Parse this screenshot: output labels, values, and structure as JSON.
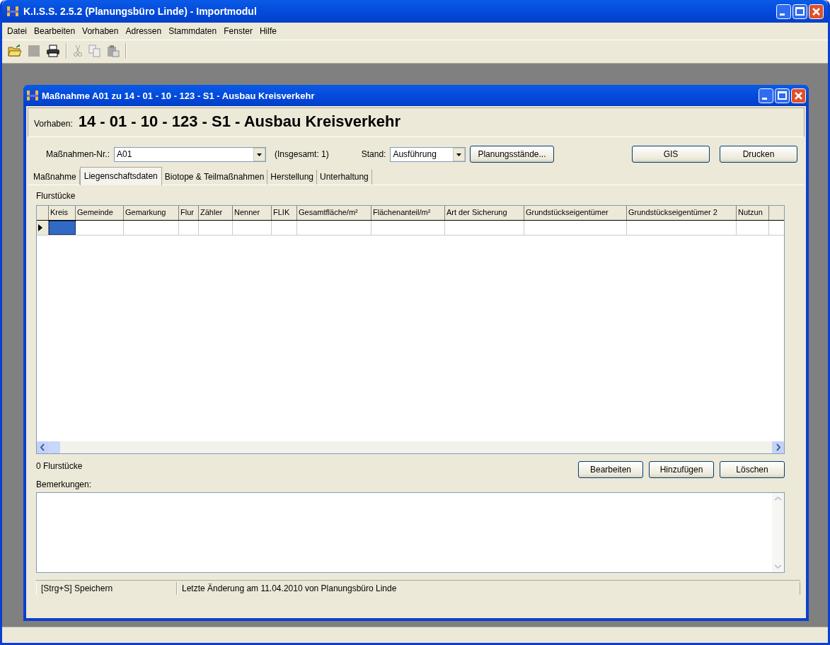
{
  "window": {
    "title": "K.I.S.S. 2.5.2 (Planungsbüro Linde) - Importmodul"
  },
  "menu": [
    "Datei",
    "Bearbeiten",
    "Vorhaben",
    "Adressen",
    "Stammdaten",
    "Fenster",
    "Hilfe"
  ],
  "toolbar": [
    {
      "kind": "open",
      "disabled": false
    },
    {
      "kind": "save",
      "disabled": true
    },
    {
      "kind": "print",
      "disabled": false
    },
    {
      "kind": "sep"
    },
    {
      "kind": "cut",
      "disabled": true
    },
    {
      "kind": "copy",
      "disabled": true
    },
    {
      "kind": "paste",
      "disabled": true
    },
    {
      "kind": "sep"
    }
  ],
  "child": {
    "title": "Maßnahme A01 zu 14 - 01 - 10 - 123 - S1 - Ausbau Kreisverkehr",
    "vorhaben_label": "Vorhaben:",
    "vorhaben": "14 - 01 - 10 - 123 - S1 - Ausbau Kreisverkehr",
    "massnahme_label": "Maßnahmen-Nr.:",
    "massnahme_value": "A01",
    "total": "(Insgesamt: 1)",
    "stand_label": "Stand:",
    "stand_value": "Ausführung",
    "buttons": [
      {
        "label": "Planungsstände...",
        "kind": "plain"
      },
      {
        "label": "GIS",
        "kind": "wide"
      },
      {
        "label": "Drucken",
        "kind": "wide"
      }
    ],
    "tabs": [
      {
        "label": "Maßnahme",
        "selected": false
      },
      {
        "label": "Liegenschaftsdaten",
        "selected": true
      },
      {
        "label": "Biotope & Teilmaßnahmen",
        "selected": false
      },
      {
        "label": "Herstellung",
        "selected": false
      },
      {
        "label": "Unterhaltung",
        "selected": false
      }
    ],
    "section_label": "Flurstücke",
    "table": {
      "columns": [
        "Kreis",
        "Gemeinde",
        "Gemarkung",
        "Flur",
        "Zähler",
        "Nenner",
        "FLIK",
        "Gesamtfläche/m²",
        "Flächenanteil/m²",
        "Art der Sicherung",
        "Grundstückseigentümer",
        "Grundstückseigentümer 2",
        "Nutzun"
      ],
      "rows": [
        {
          "current": true
        }
      ]
    },
    "count": "0 Flurstücke",
    "actions": [
      "Bearbeiten",
      "Hinzufügen",
      "Löschen"
    ],
    "remarks_label": "Bemerkungen:",
    "status": [
      "[Strg+S] Speichern",
      "Letzte Änderung am 11.04.2010 von Planungsbüro Linde"
    ]
  }
}
